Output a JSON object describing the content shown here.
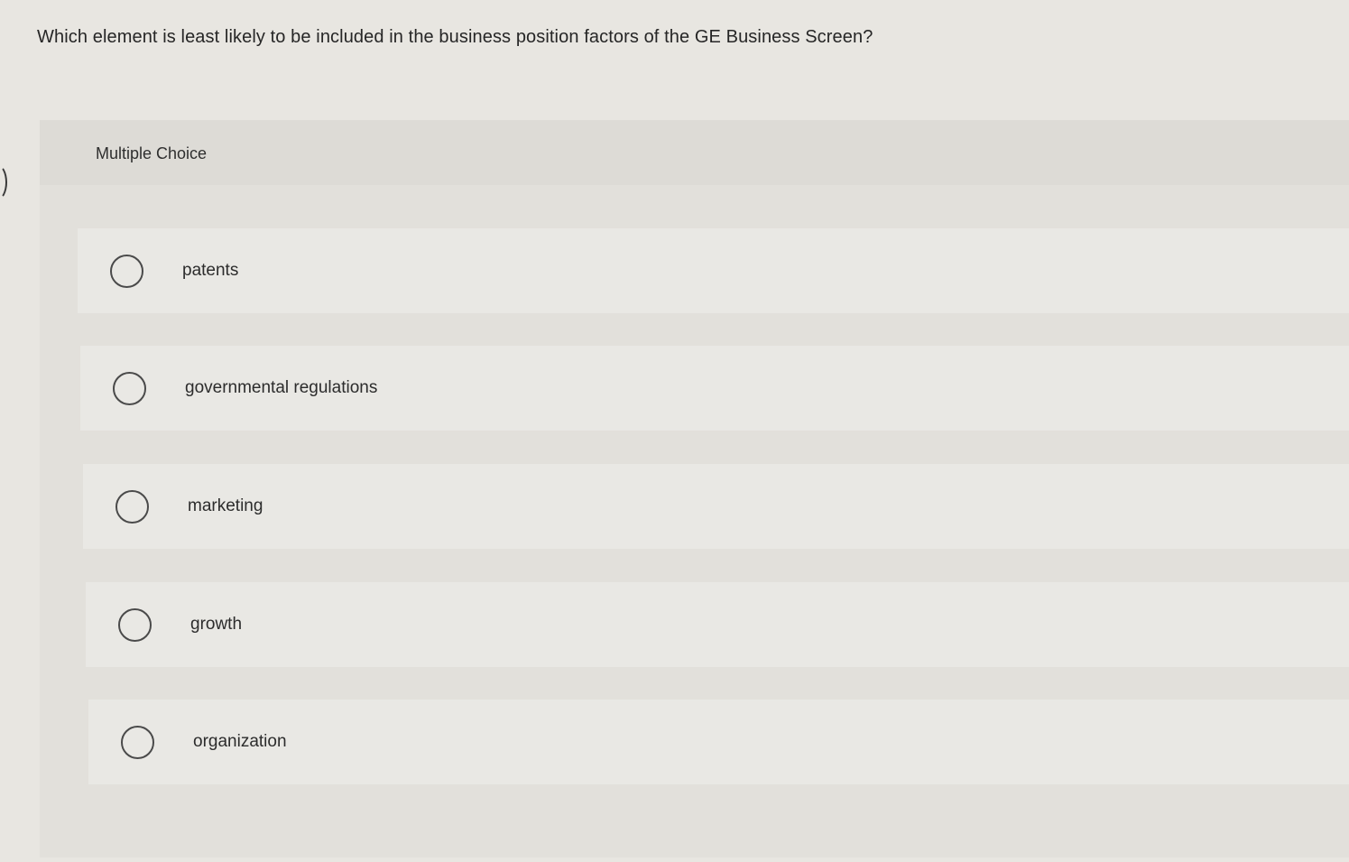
{
  "question": {
    "text": "Which element is least likely to be included in the business position factors of the GE Business Screen?"
  },
  "panel": {
    "title": "Multiple Choice"
  },
  "options": [
    {
      "label": "patents",
      "selected": false
    },
    {
      "label": "governmental regulations",
      "selected": false
    },
    {
      "label": "marketing",
      "selected": false
    },
    {
      "label": "growth",
      "selected": false
    },
    {
      "label": "organization",
      "selected": false
    }
  ]
}
